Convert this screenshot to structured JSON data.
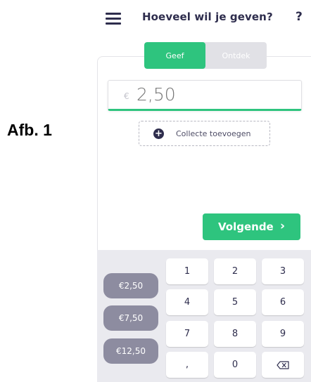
{
  "figure_label": "Afb. 1",
  "header": {
    "title": "Hoeveel wil je geven?",
    "help": "?"
  },
  "toggle": {
    "options": [
      "Geef",
      "Ontdek"
    ],
    "active": "Geef"
  },
  "amount": {
    "currency_symbol": "€",
    "placeholder": "2,50"
  },
  "add_collect": {
    "label": "Collecte toevoegen"
  },
  "next_button": {
    "label": "Volgende",
    "chevron": "›"
  },
  "presets": [
    "€2,50",
    "€7,50",
    "€12,50"
  ],
  "keypad": {
    "keys": [
      [
        "1",
        "2",
        "3"
      ],
      [
        "4",
        "5",
        "6"
      ],
      [
        "7",
        "8",
        "9"
      ],
      [
        ",",
        "0",
        "backspace"
      ]
    ]
  },
  "colors": {
    "accent": "#2ec47e",
    "text_dark": "#2e2d4d",
    "preset_bg": "#8d8ca0",
    "keypad_bg": "#eaeaef"
  }
}
